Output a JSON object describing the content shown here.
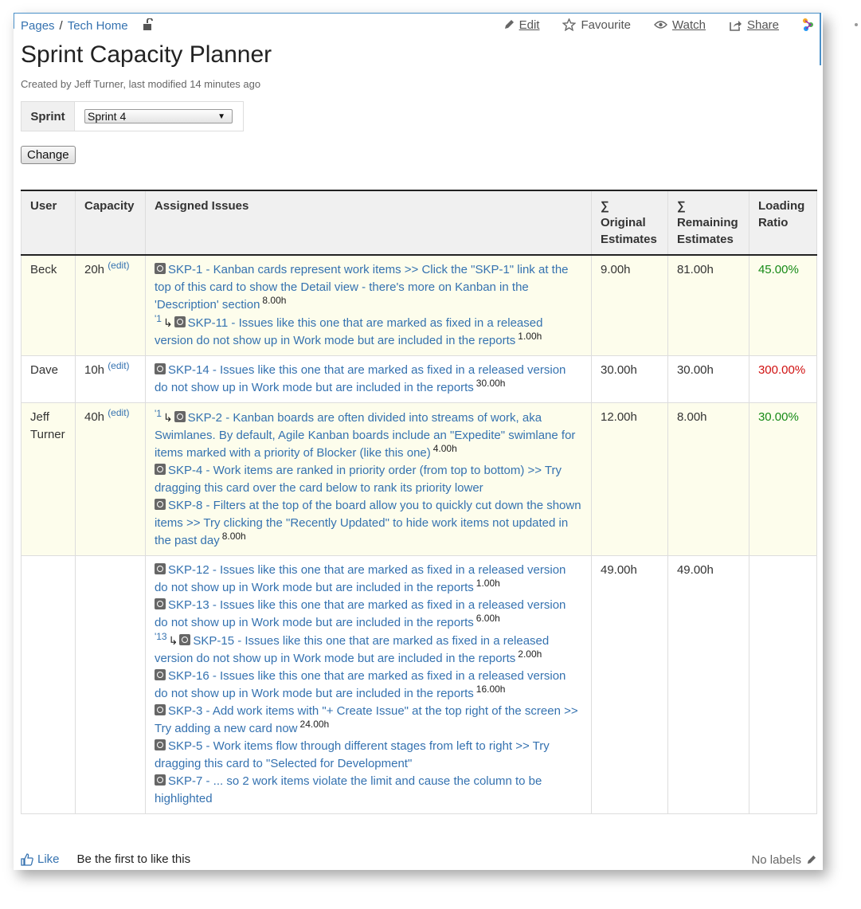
{
  "breadcrumb": {
    "pages": "Pages",
    "sep": "/",
    "space": "Tech Home"
  },
  "actions": {
    "edit": "Edit",
    "favourite": "Favourite",
    "watch": "Watch",
    "share": "Share"
  },
  "page": {
    "title": "Sprint Capacity Planner",
    "meta": "Created by Jeff Turner, last modified 14 minutes ago"
  },
  "form": {
    "sprint_label": "Sprint",
    "sprint_value": "Sprint 4",
    "change_button": "Change"
  },
  "table": {
    "headers": {
      "user": "User",
      "capacity": "Capacity",
      "issues": "Assigned Issues",
      "orig": "∑ Original Estimates",
      "remain": "∑ Remaining Estimates",
      "ratio": "Loading Ratio"
    },
    "rows": [
      {
        "user": "Beck",
        "capacity": "20h",
        "edit": "(edit)",
        "issues": [
          {
            "text": "SKP-1 - Kanban cards represent work items >> Click the \"SKP-1\" link at the top of this card to show the Detail view - there's more on Kanban in the 'Description' section",
            "est": "8.00h"
          },
          {
            "parent": "'1",
            "text": "SKP-11 - Issues like this one that are marked as fixed in a released version do not show up in Work mode but are included in the reports",
            "est": "1.00h"
          }
        ],
        "orig": "9.00h",
        "remain": "81.00h",
        "ratio": "45.00%"
      },
      {
        "user": "Dave",
        "capacity": "10h",
        "edit": "(edit)",
        "issues": [
          {
            "text": "SKP-14 - Issues like this one that are marked as fixed in a released version do not show up in Work mode but are included in the reports",
            "est": "30.00h"
          }
        ],
        "orig": "30.00h",
        "remain": "30.00h",
        "ratio": "300.00%"
      },
      {
        "user": "Jeff Turner",
        "capacity": "40h",
        "edit": "(edit)",
        "issues": [
          {
            "parent": "'1",
            "text": "SKP-2 - Kanban boards are often divided into streams of work, aka Swimlanes. By default, Agile Kanban boards include an \"Expedite\" swimlane for items marked with a priority of Blocker (like this one)",
            "est": "4.00h"
          },
          {
            "text": "SKP-4 - Work items are ranked in priority order (from top to bottom) >> Try dragging this card over the card below to rank its priority lower",
            "est": ""
          },
          {
            "text": "SKP-8 - Filters at the top of the board allow you to quickly cut down the shown items >> Try clicking the \"Recently Updated\" to hide work items not updated in the past day",
            "est": "8.00h"
          }
        ],
        "orig": "12.00h",
        "remain": "8.00h",
        "ratio": "30.00%"
      },
      {
        "user": "",
        "capacity": "",
        "edit": "",
        "issues": [
          {
            "text": "SKP-12 - Issues like this one that are marked as fixed in a released version do not show up in Work mode but are included in the reports",
            "est": "1.00h"
          },
          {
            "text": "SKP-13 - Issues like this one that are marked as fixed in a released version do not show up in Work mode but are included in the reports",
            "est": "6.00h"
          },
          {
            "parent": "'13",
            "text": "SKP-15 - Issues like this one that are marked as fixed in a released version do not show up in Work mode but are included in the reports",
            "est": "2.00h"
          },
          {
            "text": "SKP-16 - Issues like this one that are marked as fixed in a released version do not show up in Work mode but are included in the reports",
            "est": "16.00h"
          },
          {
            "text": "SKP-3 - Add work items with \"+ Create Issue\" at the top right of the screen >> Try adding a new card now",
            "est": "24.00h"
          },
          {
            "text": "SKP-5 - Work items flow through different stages from left to right >> Try dragging this card to \"Selected for Development\"",
            "est": ""
          },
          {
            "text": "SKP-7 - ... so 2 work items violate the limit and cause the column to be highlighted",
            "est": ""
          }
        ],
        "orig": "49.00h",
        "remain": "49.00h",
        "ratio": ""
      }
    ]
  },
  "footer": {
    "like": "Like",
    "first_like": "Be the first to like this",
    "no_labels": "No labels"
  }
}
